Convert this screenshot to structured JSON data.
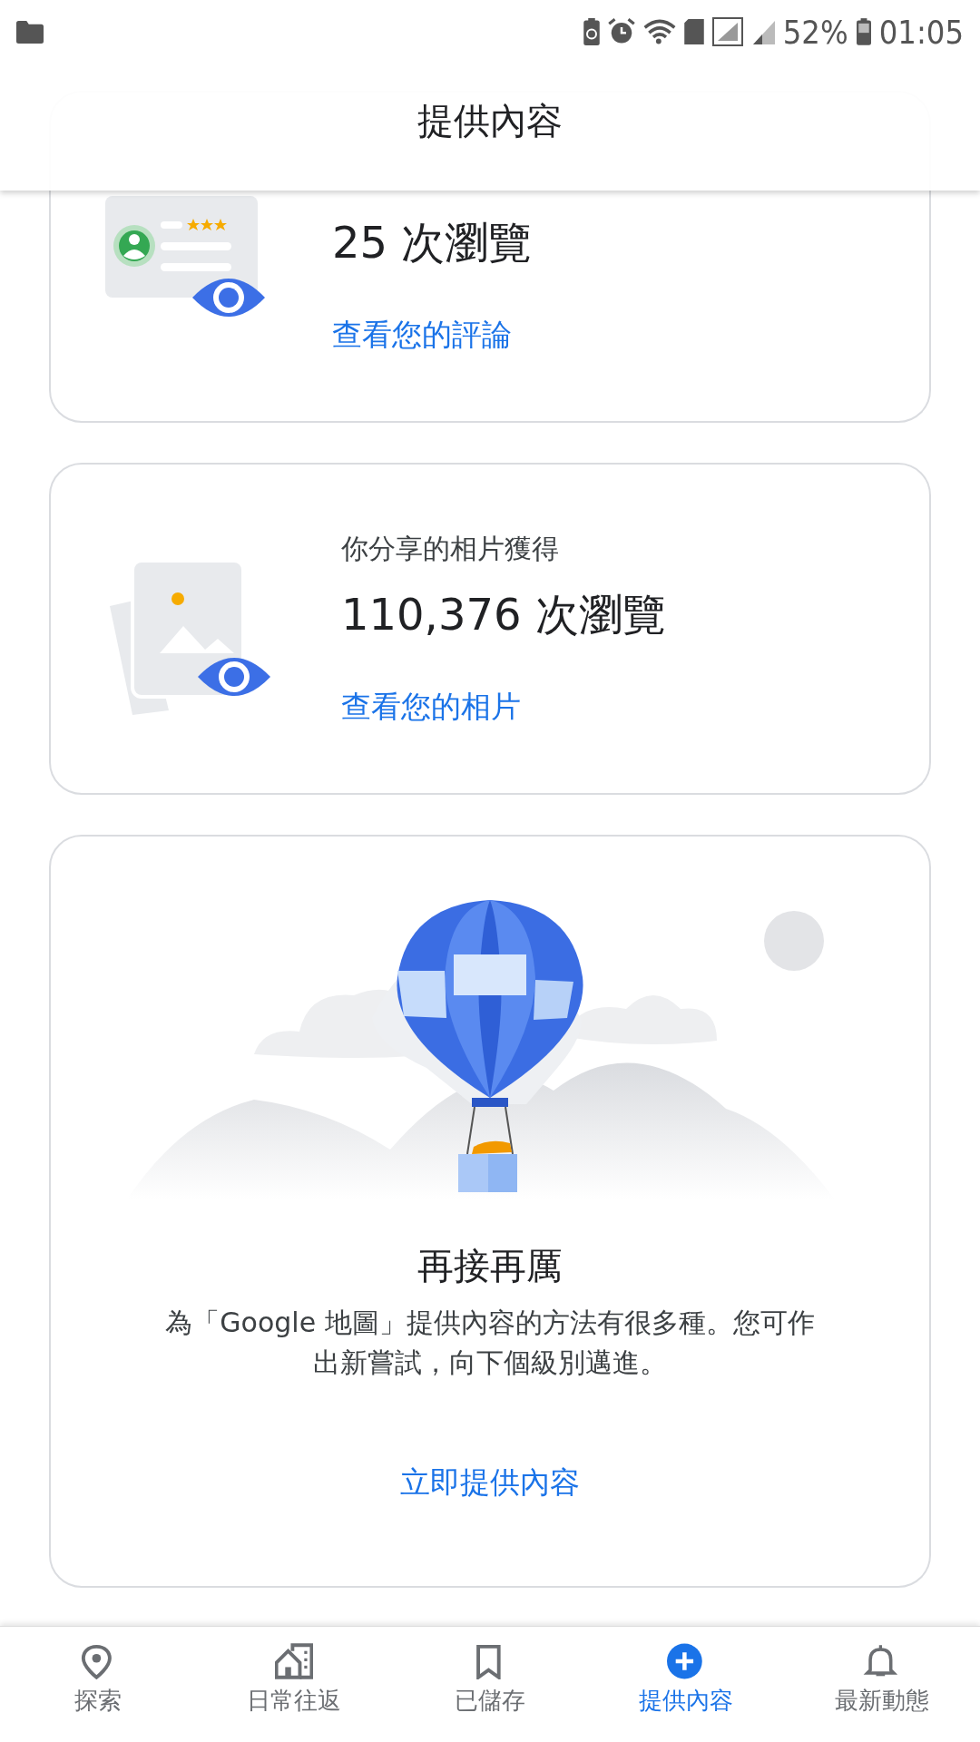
{
  "status_bar": {
    "battery_percent": "52%",
    "time": "01:05"
  },
  "header": {
    "title": "提供內容"
  },
  "stat_cards": [
    {
      "kind": "reviews",
      "value": "25 次瀏覽",
      "link": "查看您的評論"
    },
    {
      "kind": "photos",
      "caption": "你分享的相片獲得",
      "value": "110,376 次瀏覽",
      "link": "查看您的相片"
    }
  ],
  "promo_card": {
    "title": "再接再厲",
    "body": "為「Google 地圖」提供內容的方法有很多種。您可作出新嘗試，向下個級別邁進。",
    "link": "立即提供內容"
  },
  "bottom_nav": [
    {
      "kind": "explore",
      "label": "探索",
      "selected": false
    },
    {
      "kind": "commute",
      "label": "日常往返",
      "selected": false
    },
    {
      "kind": "saved",
      "label": "已儲存",
      "selected": false
    },
    {
      "kind": "contribute",
      "label": "提供內容",
      "selected": true
    },
    {
      "kind": "updates",
      "label": "最新動態",
      "selected": false
    }
  ]
}
